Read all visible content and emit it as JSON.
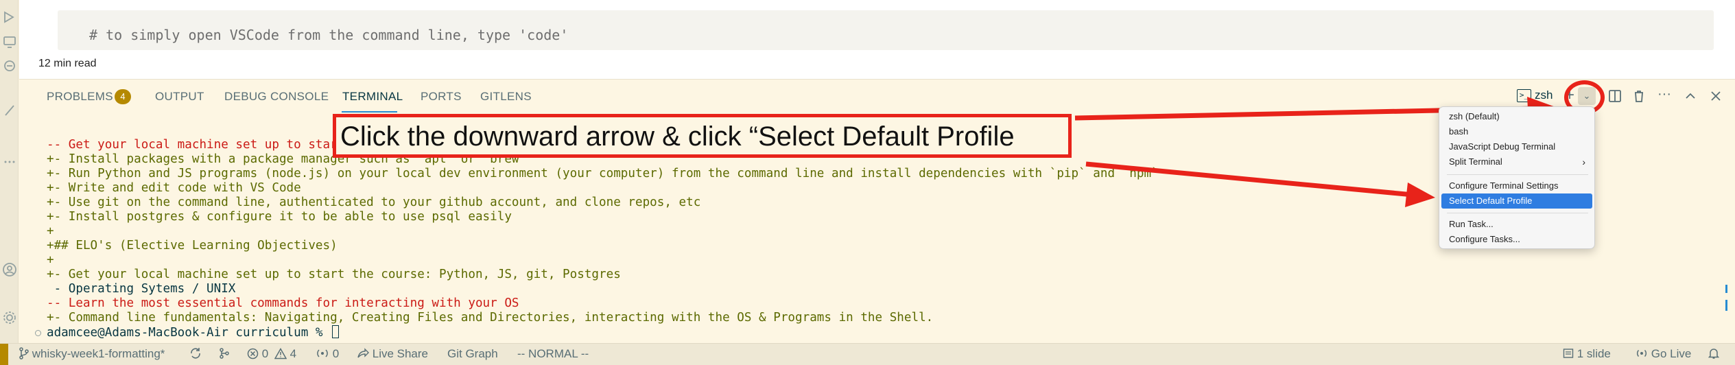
{
  "editor": {
    "code_comment": "# to simply open VSCode from the command line, type 'code'",
    "read_time": "12 min read"
  },
  "panel": {
    "tabs": [
      {
        "label": "PROBLEMS",
        "badge": "4"
      },
      {
        "label": "OUTPUT"
      },
      {
        "label": "DEBUG CONSOLE"
      },
      {
        "label": "TERMINAL",
        "active": true
      },
      {
        "label": "PORTS"
      },
      {
        "label": "GITLENS"
      }
    ],
    "terminal_profile": "zsh",
    "profile_icon_glyph": ">_",
    "plus_glyph": "+",
    "chevron_glyph": "⌄",
    "more_glyph": "···",
    "maximize_glyph": "⌃",
    "close_glyph": "✕"
  },
  "terminal": {
    "lines": [
      {
        "text": "-- Get your local machine set up to start the course",
        "color": "red"
      },
      {
        "text": "+- Install packages with a package manager such as `apt` or `brew`",
        "color": "olive"
      },
      {
        "text": "+- Run Python and JS programs (node.js) on your local dev environment (your computer) from the command line and install dependencies with `pip` and `npm`",
        "color": "olive"
      },
      {
        "text": "+- Write and edit code with VS Code",
        "color": "olive"
      },
      {
        "text": "+- Use git on the command line, authenticated to your github account, and clone repos, etc",
        "color": "olive"
      },
      {
        "text": "+- Install postgres & configure it to be able to use psql easily",
        "color": "olive"
      },
      {
        "text": "+",
        "color": "olive"
      },
      {
        "text": "+## ELO's (Elective Learning Objectives)",
        "color": "olive"
      },
      {
        "text": "+",
        "color": "olive"
      },
      {
        "text": "+- Get your local machine set up to start the course: Python, JS, git, Postgres",
        "color": "olive"
      },
      {
        "text": " - Operating Sytems / UNIX",
        "color": "dark"
      },
      {
        "text": "-- Learn the most essential commands for interacting with your OS",
        "color": "red"
      },
      {
        "text": "+- Command line fundamentals: Navigating, Creating Files and Directories, interacting with the OS & Programs in the Shell.",
        "color": "olive"
      }
    ],
    "prompt": "adamcee@Adams-MacBook-Air curriculum % "
  },
  "dropdown": {
    "items": [
      {
        "label": "zsh (Default)"
      },
      {
        "label": "bash"
      },
      {
        "label": "JavaScript Debug Terminal"
      },
      {
        "label": "Split Terminal",
        "submenu": true,
        "chevron": "›"
      },
      {
        "label": "Configure Terminal Settings"
      },
      {
        "label": "Select Default Profile",
        "selected": true
      },
      {
        "label": "Run Task..."
      },
      {
        "label": "Configure Tasks..."
      }
    ]
  },
  "annotation": {
    "callout_text": "Click the downward arrow & click “Select Default Profile",
    "color": "#e8231a"
  },
  "statusbar": {
    "branch": "whisky-week1-formatting*",
    "errors": "0",
    "warnings": "4",
    "ports": "0",
    "live_share": "Live Share",
    "git_graph": "Git Graph",
    "vim_mode": "-- NORMAL --",
    "slides": "1 slide",
    "go_live": "Go Live"
  },
  "colors": {
    "background": "#fdf6e3",
    "accent": "#268bd2",
    "badge": "#b58900",
    "diff_removed": "#cb1b16",
    "diff_added": "#5c6a00"
  }
}
